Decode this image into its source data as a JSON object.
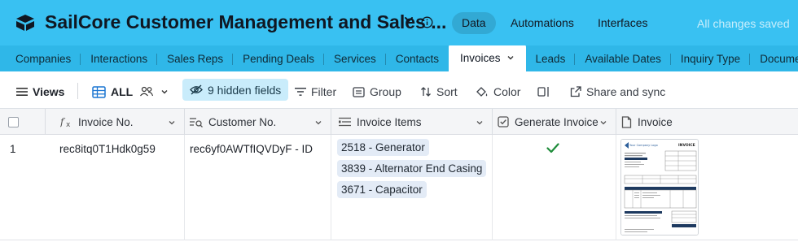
{
  "header": {
    "title": "SailCore Customer Management and Sales ...",
    "nav": [
      "Data",
      "Automations",
      "Interfaces"
    ],
    "active_nav": "Data",
    "saved_status": "All changes saved",
    "bg_color": "#39c1f2"
  },
  "tabs": [
    {
      "label": "Companies"
    },
    {
      "label": "Interactions"
    },
    {
      "label": "Sales Reps"
    },
    {
      "label": "Pending Deals"
    },
    {
      "label": "Services"
    },
    {
      "label": "Contacts"
    },
    {
      "label": "Invoices",
      "active": true
    },
    {
      "label": "Leads"
    },
    {
      "label": "Available Dates"
    },
    {
      "label": "Inquiry Type"
    },
    {
      "label": "Documents"
    }
  ],
  "toolbar": {
    "views": "Views",
    "view_name": "ALL",
    "hidden_fields": "9 hidden fields",
    "filter": "Filter",
    "group": "Group",
    "sort": "Sort",
    "color": "Color",
    "share": "Share and sync"
  },
  "columns": [
    {
      "label": "Invoice No.",
      "icon": "formula-icon"
    },
    {
      "label": "Customer No.",
      "icon": "lookup-icon"
    },
    {
      "label": "Invoice Items",
      "icon": "link-list-icon"
    },
    {
      "label": "Generate Invoice",
      "icon": "checkbox-icon"
    },
    {
      "label": "Invoice",
      "icon": "document-icon"
    }
  ],
  "rows": [
    {
      "index": "1",
      "invoice_no": "rec8itq0T1Hdk0g59",
      "customer_no": "rec6yf0AWTfIQVDyF - ID",
      "items": [
        "2518 - Generator",
        "3839 - Alternator End Casing",
        "3671 - Capacitor"
      ],
      "generate_invoice": true
    }
  ],
  "invoice_doc": {
    "heading": "INVOICE",
    "company": "Your Company Logo"
  }
}
